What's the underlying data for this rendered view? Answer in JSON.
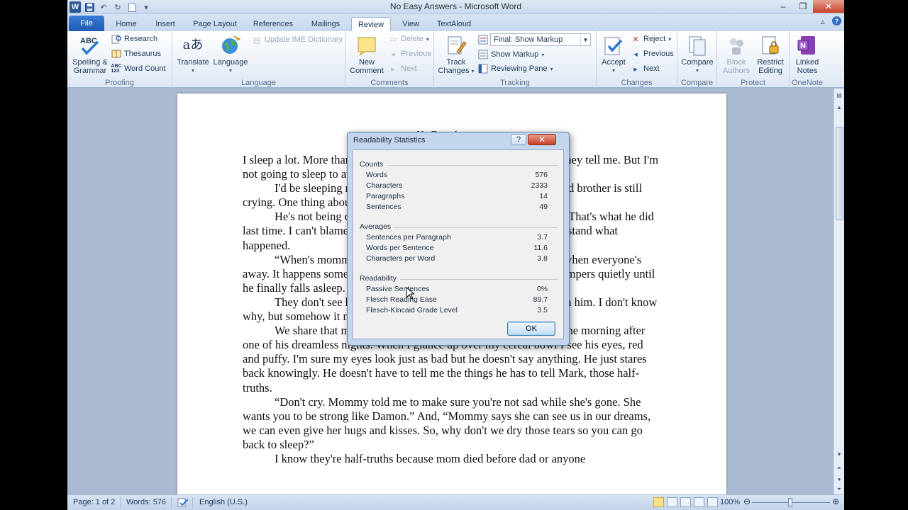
{
  "window": {
    "title": "No Easy Answers - Microsoft Word"
  },
  "tabs": [
    {
      "label": "File"
    },
    {
      "label": "Home"
    },
    {
      "label": "Insert"
    },
    {
      "label": "Page Layout"
    },
    {
      "label": "References"
    },
    {
      "label": "Mailings"
    },
    {
      "label": "Review"
    },
    {
      "label": "View"
    },
    {
      "label": "TextAloud"
    }
  ],
  "active_tab": "Review",
  "ribbon": {
    "proofing": {
      "label": "Proofing",
      "spelling": "Spelling &",
      "spelling2": "Grammar",
      "research": "Research",
      "thesaurus": "Thesaurus",
      "word_count": "Word Count"
    },
    "language": {
      "label": "Language",
      "translate": "Translate",
      "language": "Language",
      "update_ime": "Update IME Dictionary"
    },
    "comments": {
      "label": "Comments",
      "new1": "New",
      "new2": "Comment",
      "delete": "Delete",
      "previous": "Previous",
      "next": "Next"
    },
    "tracking": {
      "label": "Tracking",
      "track1": "Track",
      "track2": "Changes",
      "markup_mode": "Final: Show Markup",
      "show_markup": "Show Markup",
      "reviewing_pane": "Reviewing Pane"
    },
    "changes": {
      "label": "Changes",
      "accept": "Accept",
      "reject": "Reject",
      "previous": "Previous",
      "next": "Next"
    },
    "compare": {
      "label": "Compare",
      "compare": "Compare"
    },
    "protect": {
      "label": "Protect",
      "block1": "Block",
      "block2": "Authors",
      "restrict1": "Restrict",
      "restrict2": "Editing"
    },
    "onenote": {
      "label": "OneNote",
      "linked1": "Linked",
      "linked2": "Notes"
    }
  },
  "document": {
    "heading": "No Easy Answers",
    "paragraphs": [
      "I sleep a lot. More than most kids my age. I'm only six years old, so they tell me. But I'm not going to sleep to avoid things, I'm no babe.",
      "I'd be sleeping right now if it wasn't for Mark. My four-year-old brother is still crying. One thing about Mark, he doesn't cry, he's crying.",
      "He's not being quiet about it either, he's going to wake up dad. That's what he did last time. I can't blame him. I don't blame him. He doesn't even understand what happened.",
      "“When's mommy coming home?” he asks me during the day, when everyone's away. It happens sometimes and cries in front of everyone. Mark whimpers quietly until he finally falls asleep.",
      "They don't see him crying because no one ever sees it, not even him. I don't know why, but somehow it makes me feel like I'm older, stronger, like dad.",
      "We share that much, him and me. Sometimes I look at him in the morning after one of his dreamless nights. When I glance up over my cereal bowl I see his eyes, red and puffy. I'm sure my eyes look just as bad but he doesn't say anything. He just stares back knowingly. He doesn't have to tell me the things he has to tell Mark, those half-truths.",
      "“Don't cry. Mommy told me to make sure you're not sad while she's gone. She wants you to be strong like Damon.” And, “Mommy says she can see us in our dreams, we can even give her hugs and kisses. So, why don't we dry those tears so you can go back to sleep?”",
      "I know they're half-truths because mom died before dad or anyone"
    ]
  },
  "dialog": {
    "title": "Readability Statistics",
    "help": "?",
    "counts_head": "Counts",
    "counts": [
      {
        "label": "Words",
        "value": "576"
      },
      {
        "label": "Characters",
        "value": "2333"
      },
      {
        "label": "Paragraphs",
        "value": "14"
      },
      {
        "label": "Sentences",
        "value": "49"
      }
    ],
    "averages_head": "Averages",
    "averages": [
      {
        "label": "Sentences per Paragraph",
        "value": "3.7"
      },
      {
        "label": "Words per Sentence",
        "value": "11.6"
      },
      {
        "label": "Characters per Word",
        "value": "3.8"
      }
    ],
    "readability_head": "Readability",
    "readability": [
      {
        "label": "Passive Sentences",
        "value": "0%"
      },
      {
        "label": "Flesch Reading Ease",
        "value": "89.7"
      },
      {
        "label": "Flesch-Kincaid Grade Level",
        "value": "3.5"
      }
    ],
    "ok": "OK"
  },
  "status": {
    "page": "Page: 1 of 2",
    "words": "Words: 576",
    "language": "English (U.S.)",
    "zoom": "100%"
  },
  "colors": {
    "file_tab": "#2b5797",
    "accent": "#1e395b",
    "close": "#c7412b"
  }
}
